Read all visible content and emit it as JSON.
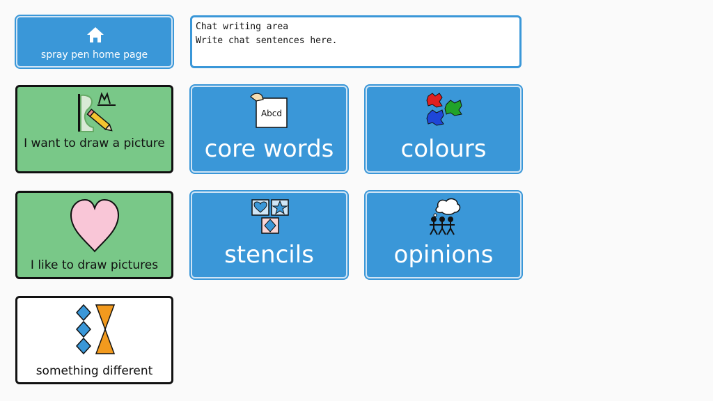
{
  "home": {
    "label": "spray pen home page",
    "icon": "home-icon"
  },
  "chat": {
    "title": "Chat writing area",
    "placeholder": "Write chat sentences here."
  },
  "cells": {
    "draw_picture": {
      "label": "I want to draw a picture",
      "icon": "drawing-pencil-icon"
    },
    "core_words": {
      "label": "core words",
      "icon": "abcd-card-icon"
    },
    "colours": {
      "label": "colours",
      "icon": "paint-splashes-icon"
    },
    "like_draw": {
      "label": "I like to draw pictures",
      "icon": "heart-icon"
    },
    "stencils": {
      "label": "stencils",
      "icon": "stencil-shapes-icon"
    },
    "opinions": {
      "label": "opinions",
      "icon": "people-thinking-icon"
    },
    "something_different": {
      "label": "something different",
      "icon": "shapes-different-icon"
    }
  },
  "colors": {
    "blue_cell": "#3a97d8",
    "green_cell": "#79c888",
    "heart": "#f9c6d7",
    "accent_orange": "#f29a1e"
  },
  "icon_text": {
    "card": "Abcd"
  }
}
